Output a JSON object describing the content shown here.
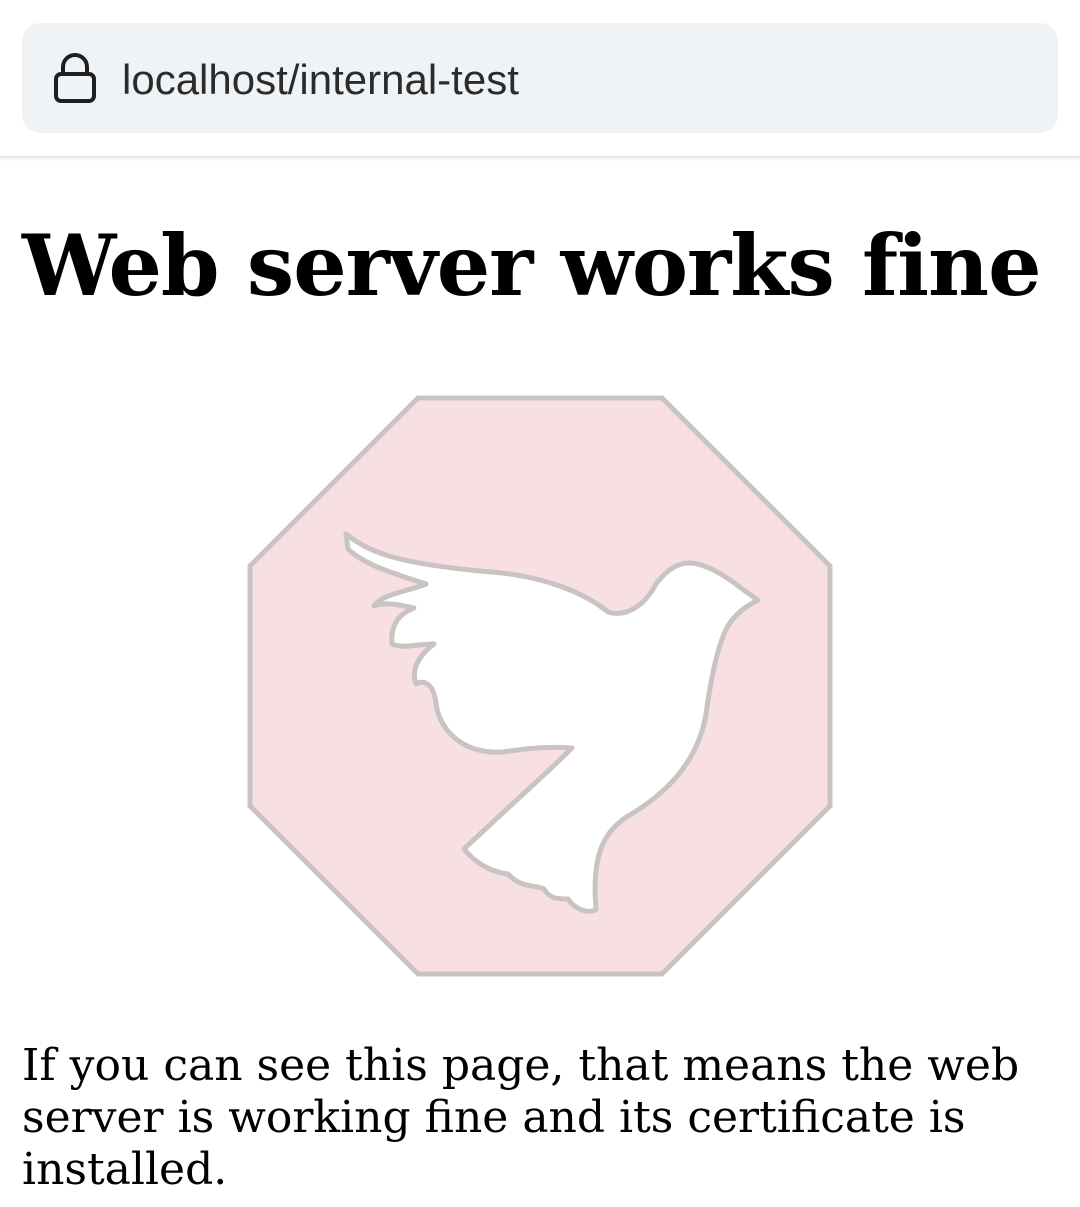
{
  "browser": {
    "url": "localhost/internal-test",
    "lock_icon": "lock-icon"
  },
  "page": {
    "title": "Web server works fine",
    "logo": {
      "icon": "dove-octagon-logo",
      "fill_color": "#f7dfe2",
      "stroke_color": "#c9c3c4"
    },
    "intro": "If you can see this page, that means the web server is working fine and its certificate is installed."
  }
}
